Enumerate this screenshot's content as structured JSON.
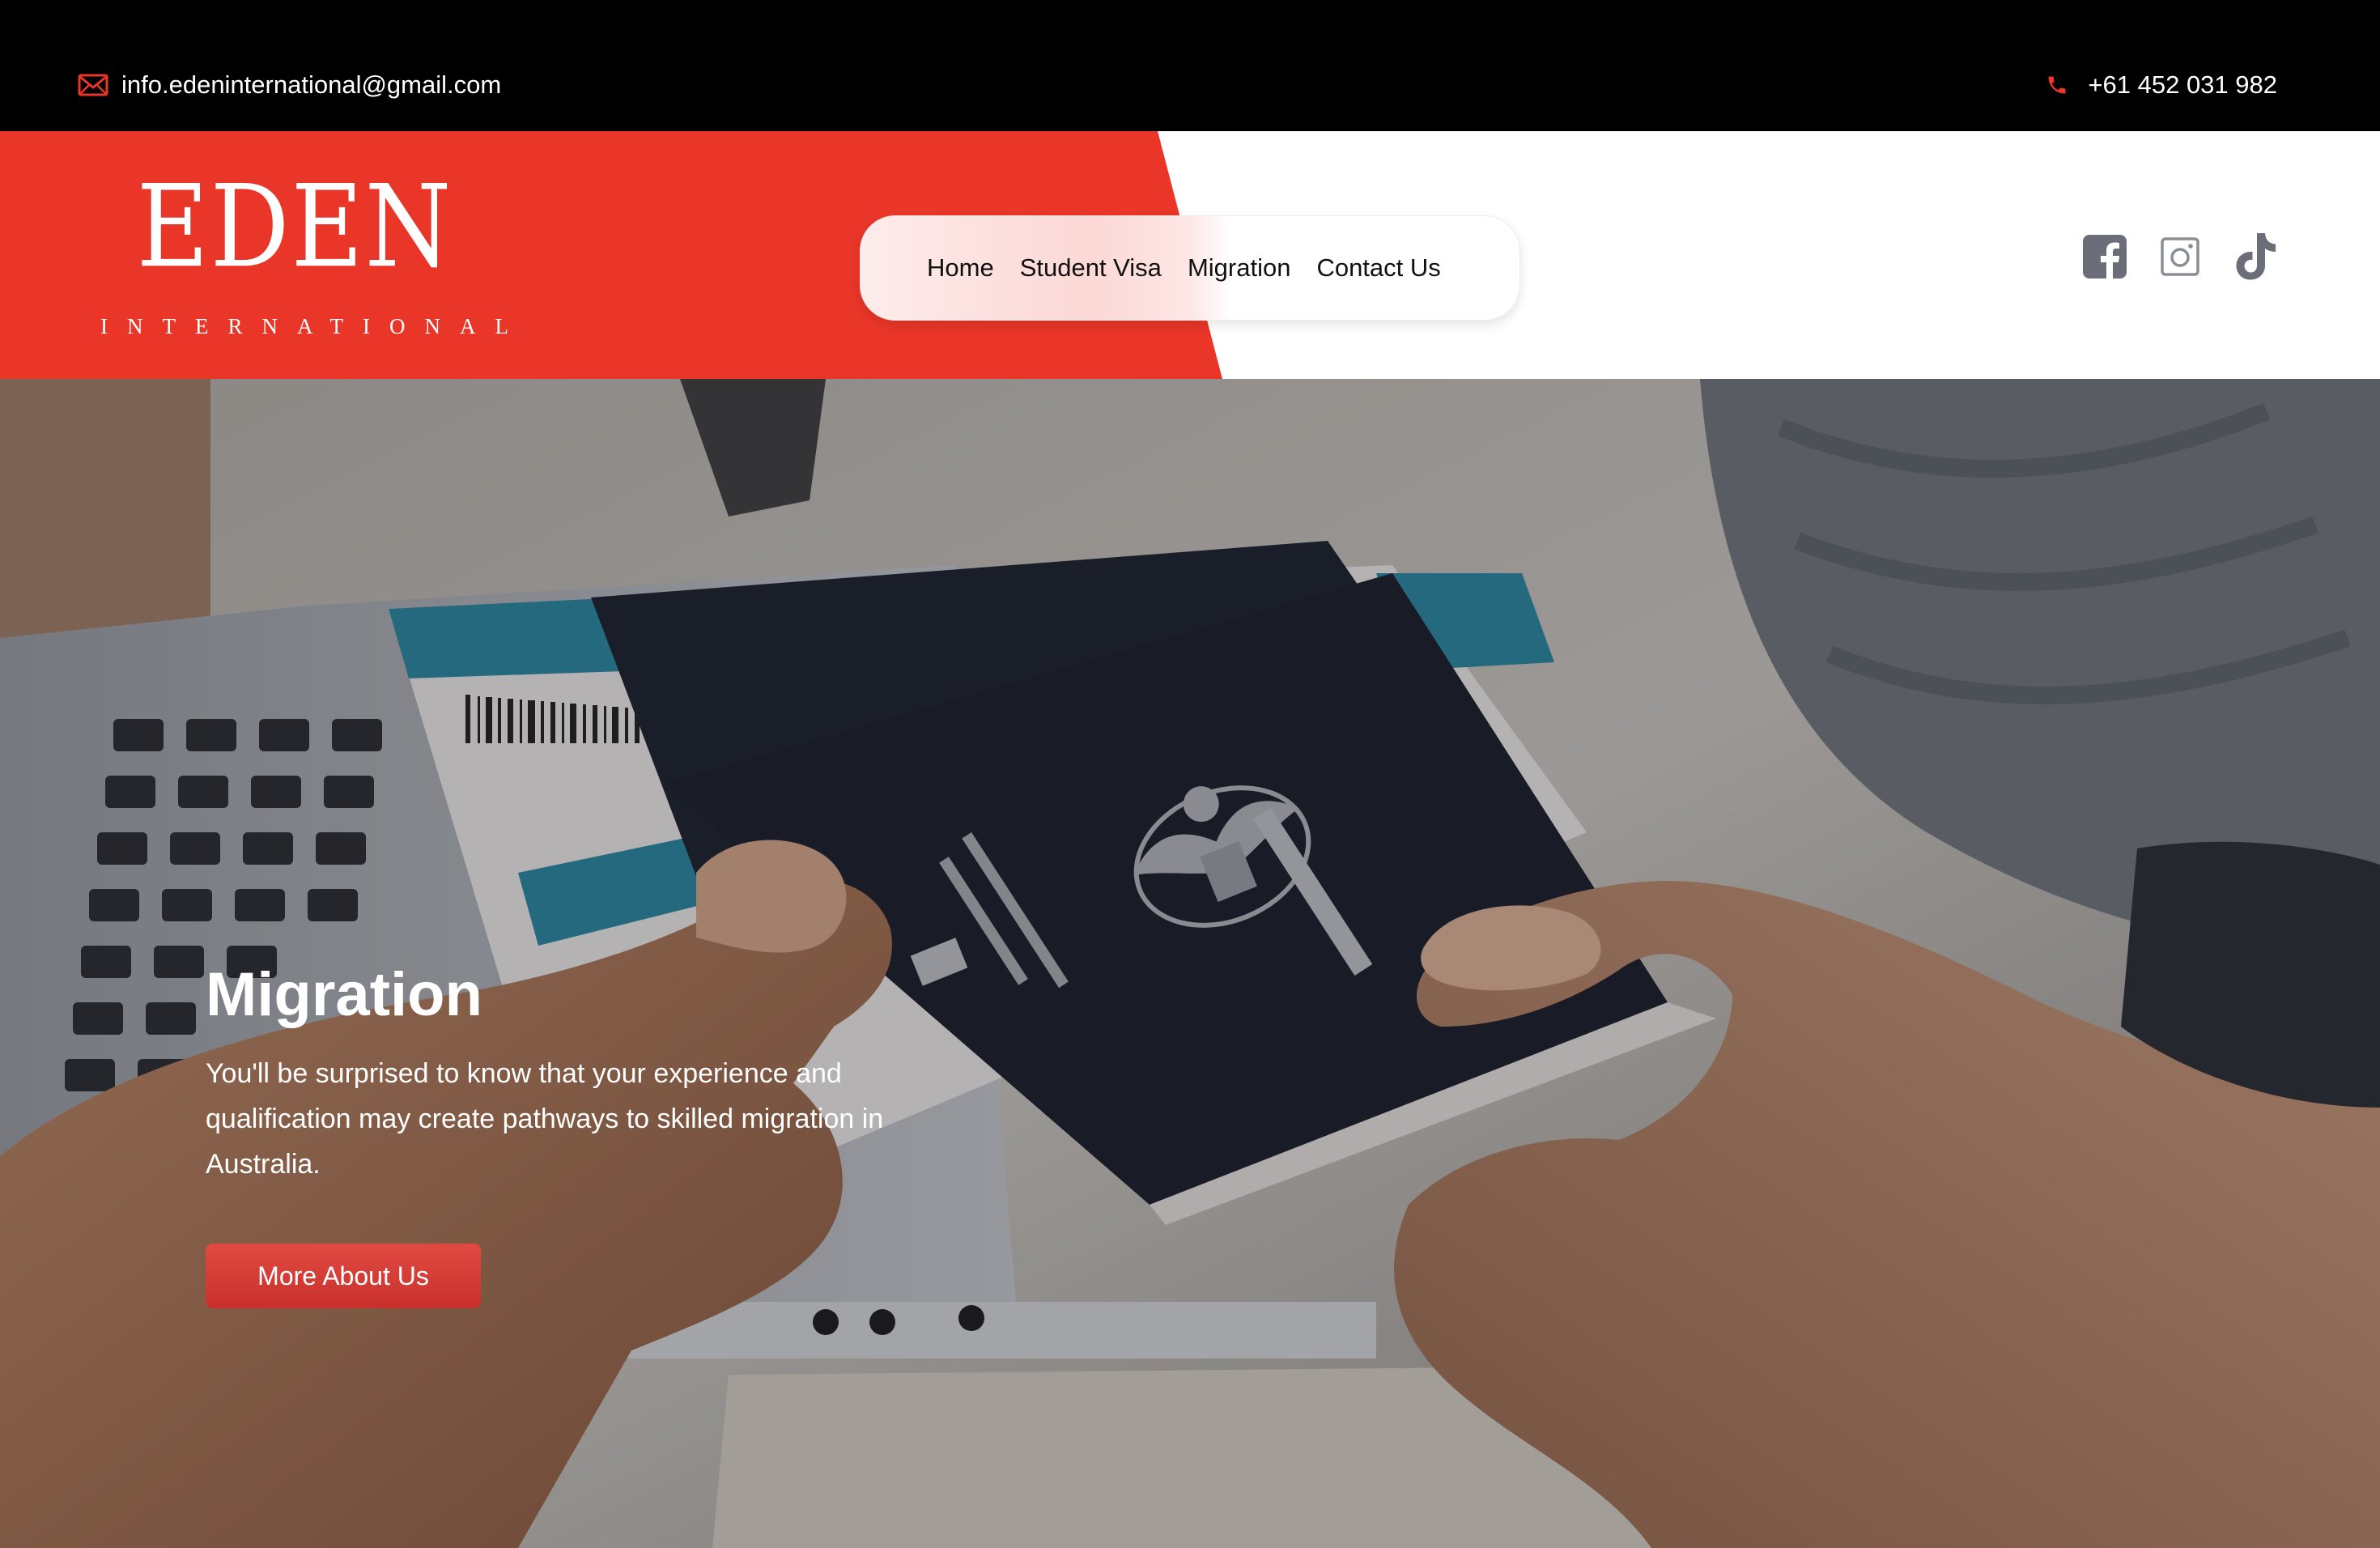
{
  "topbar": {
    "email": "info.edeninternational@gmail.com",
    "phone": "+61 452 031 982",
    "email_icon": "envelope-icon",
    "phone_icon": "phone-icon"
  },
  "logo": {
    "brand": "EDEN",
    "sub": "INTERNATIONAL"
  },
  "nav": {
    "items": [
      {
        "label": "Home"
      },
      {
        "label": "Student Visa"
      },
      {
        "label": "Migration"
      },
      {
        "label": "Contact Us"
      }
    ]
  },
  "social": {
    "icons": [
      "facebook-icon",
      "instagram-icon",
      "tiktok-icon"
    ]
  },
  "hero": {
    "title": "Migration",
    "text": "You'll be surprised to know that your experience and qualification may create pathways to skilled migration in Australia.",
    "button_label": "More About Us"
  },
  "colors": {
    "brand_red": "#e93628",
    "topbar_bg": "#000000",
    "button_red": "#d8392f",
    "social_icon": "#6b6e78"
  }
}
